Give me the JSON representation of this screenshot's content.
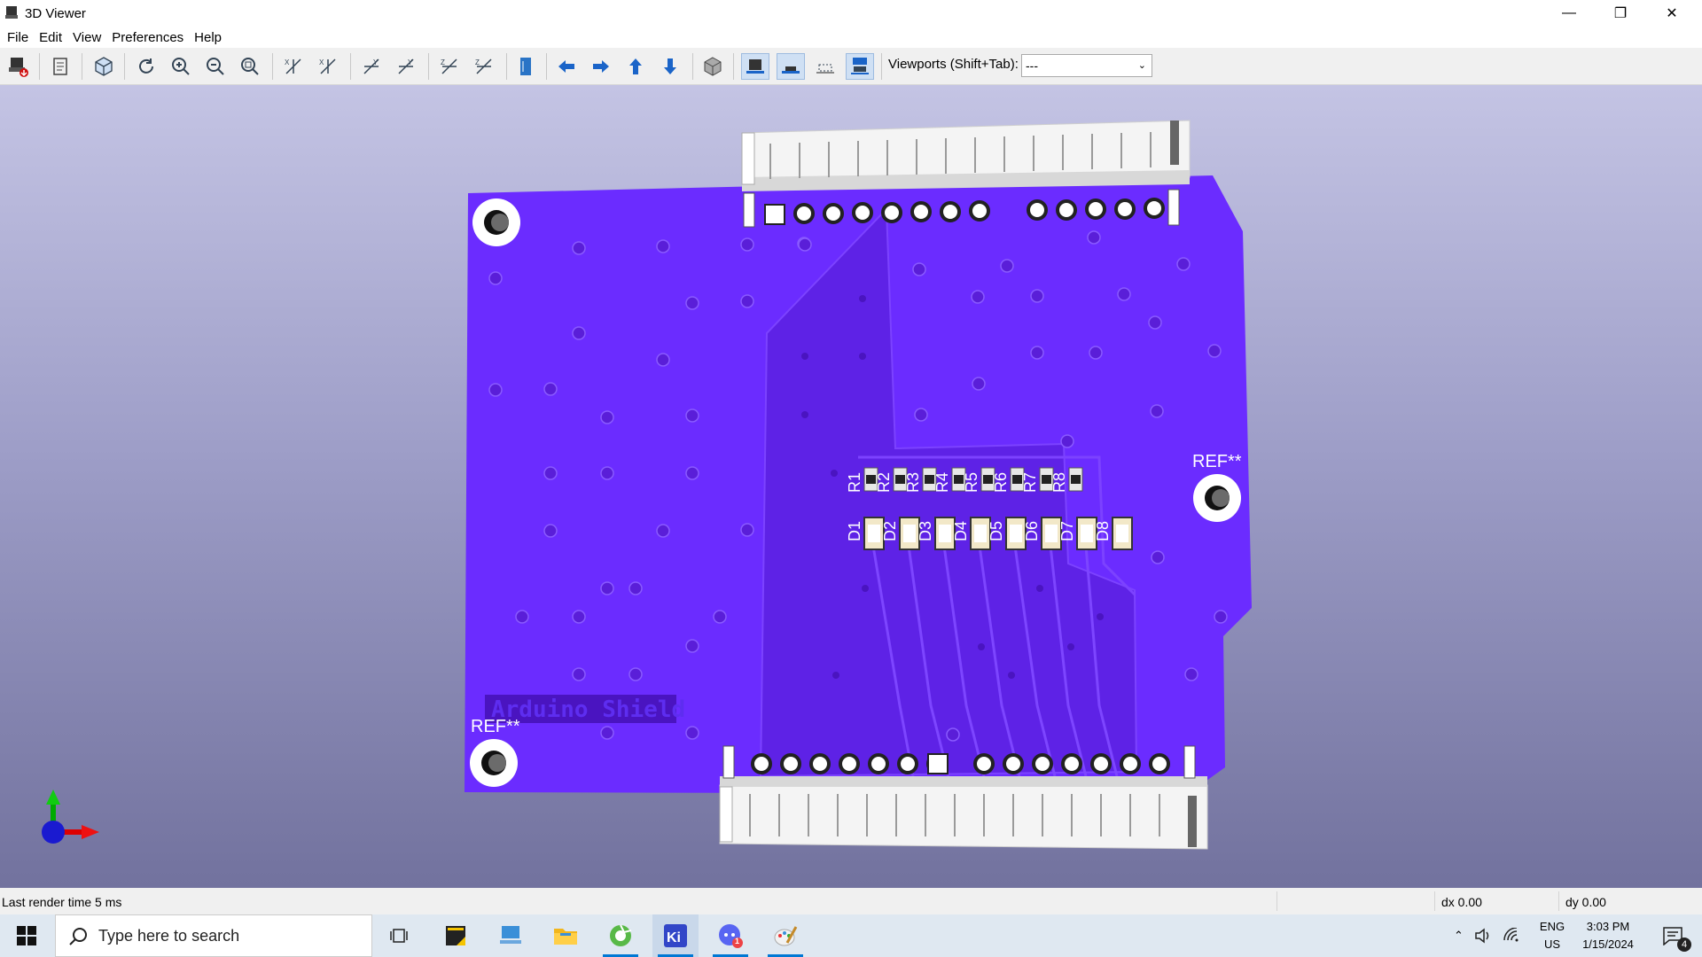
{
  "window": {
    "title": "3D Viewer",
    "controls": [
      "—",
      "❐",
      "✕"
    ]
  },
  "menu": [
    "File",
    "Edit",
    "View",
    "Preferences",
    "Help"
  ],
  "toolbar": {
    "viewports_label": "Viewports (Shift+Tab):",
    "viewports_value": "---",
    "buttons": [
      "export-image",
      "copy-to-clipboard",
      "render-options",
      "reload",
      "zoom-in",
      "zoom-out",
      "zoom-to-fit",
      "rotate-x-cw",
      "rotate-x-ccw",
      "rotate-y-cw",
      "rotate-y-ccw",
      "rotate-z-cw",
      "rotate-z-ccw",
      "flip-board",
      "pan-left",
      "pan-right",
      "pan-up",
      "pan-down",
      "toggle-ortho",
      "show-tht",
      "show-smd",
      "show-virtual",
      "show-not-in-posfile"
    ]
  },
  "board": {
    "color": "#6b2cff",
    "silkscreen": [
      "R1",
      "R2",
      "R3",
      "R4",
      "R5",
      "R6",
      "R7",
      "R8",
      "D1",
      "D2",
      "D3",
      "D4",
      "D5",
      "D6",
      "D7",
      "D8"
    ],
    "ref_labels": [
      "REF**",
      "REF**"
    ],
    "board_text": "Arduino Shield"
  },
  "status": {
    "render": "Last render time 5 ms",
    "dx": "dx 0.00",
    "dy": "dy 0.00"
  },
  "taskbar": {
    "search_placeholder": "Type here to search",
    "apps": [
      "start",
      "task-view",
      "sticky-notes",
      "network-explorer",
      "file-explorer",
      "green-app",
      "kicad",
      "discord",
      "paint"
    ],
    "discord_badge": "1",
    "lang": "ENG",
    "region": "US",
    "time": "3:03 PM",
    "date": "1/15/2024",
    "notifications": "4"
  }
}
